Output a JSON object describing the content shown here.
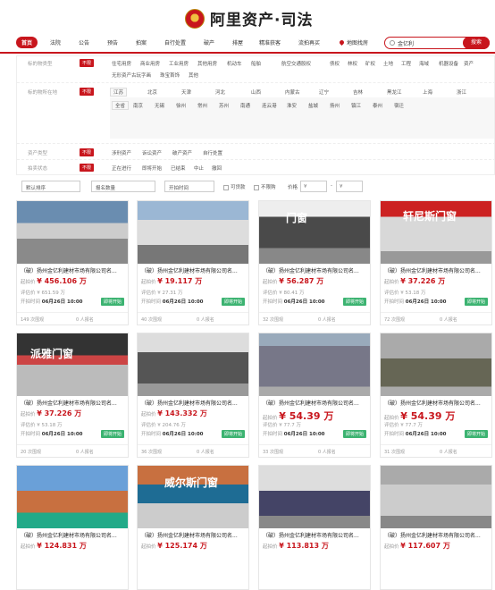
{
  "brand": {
    "title": "阿里资产·司法",
    "accent": "#c8161d"
  },
  "nav": {
    "items": [
      "首页",
      "法院",
      "公告",
      "预告",
      "拍案",
      "自行处置",
      "破产",
      "排屋",
      "精准获客",
      "流拍再买"
    ],
    "map_label": "地图找房",
    "search_value": "金亿利",
    "search_button": "搜索"
  },
  "filters": {
    "unlimited": "不限",
    "rows": [
      {
        "label": "标的物类型",
        "options": [
          "住宅用房",
          "商业用房",
          "工业用房",
          "其他用房",
          "机动车",
          "船舶",
          "航空交通",
          "股权",
          "债权",
          "林权",
          "矿权",
          "土地",
          "工程",
          "海域",
          "机器设备",
          "资产",
          "无形资产",
          "古玩字画",
          "珠宝首饰",
          "其他"
        ]
      },
      {
        "label": "标的物所在地",
        "provinces": [
          "江苏",
          "北京",
          "天津",
          "河北",
          "山西",
          "内蒙古",
          "辽宁",
          "吉林",
          "黑龙江",
          "上海",
          "浙江"
        ],
        "cities": [
          "全省",
          "南京",
          "无锡",
          "徐州",
          "常州",
          "苏州",
          "南通",
          "连云港",
          "淮安",
          "盐城",
          "扬州",
          "镇江",
          "泰州",
          "宿迁"
        ],
        "more_provinces": [
          "安徽",
          "福建",
          "江西",
          "山东",
          "河南",
          "湖北",
          "湖南",
          "广东",
          "广西",
          "海南",
          "重庆",
          "四川",
          "贵州",
          "云南",
          "西藏",
          "陕西",
          "甘肃",
          "青海",
          "宁夏",
          "新疆"
        ]
      },
      {
        "label": "资产类型",
        "options": [
          "涉刑资产",
          "诉讼资产",
          "破产资产",
          "自行处置"
        ]
      },
      {
        "label": "拍卖状态",
        "options": [
          "正在进行",
          "即将开始",
          "已结束",
          "中止",
          "撤回"
        ]
      }
    ]
  },
  "sort": {
    "default_label": "默认排序",
    "deposit_label": "报名数量",
    "time_label": "开拍时间",
    "loan_label": "可贷款",
    "limit_label": "不限购",
    "price_label": "价格",
    "price_from": "¥",
    "price_to": "¥"
  },
  "cards": [
    {
      "title": "（破）扬州金亿利建材市场有限公司名...",
      "start_label": "起拍价",
      "price": "¥ 456.106 万",
      "est_label": "评估价",
      "est": "¥ 651.59 万",
      "time_label": "开拍时间",
      "time": "06月26日 10:00",
      "status": "即将开始",
      "views": "149 次围观",
      "signups": "0 人报名"
    },
    {
      "title": "（破）扬州金亿利建材市场有限公司名...",
      "start_label": "起拍价",
      "price": "¥ 19.117 万",
      "est_label": "评估价",
      "est": "¥ 27.31 万",
      "time_label": "开拍时间",
      "time": "06月26日 10:00",
      "status": "即将开始",
      "views": "40 次围观",
      "signups": "0 人报名"
    },
    {
      "title": "（破）扬州金亿利建材市场有限公司名...",
      "start_label": "起拍价",
      "price": "¥ 56.287 万",
      "est_label": "评估价",
      "est": "¥ 80.41 万",
      "time_label": "开拍时间",
      "time": "06月26日 10:00",
      "status": "即将开始",
      "views": "32 次围观",
      "signups": "0 人报名"
    },
    {
      "title": "（破）扬州金亿利建材市场有限公司名...",
      "start_label": "起拍价",
      "price": "¥ 37.226 万",
      "est_label": "评估价",
      "est": "¥ 53.18 万",
      "time_label": "开拍时间",
      "time": "06月26日 10:00",
      "status": "即将开始",
      "views": "72 次围观",
      "signups": "0 人报名"
    },
    {
      "title": "（破）扬州金亿利建材市场有限公司名...",
      "start_label": "起拍价",
      "price": "¥ 37.226 万",
      "est_label": "评估价",
      "est": "¥ 53.18 万",
      "time_label": "开拍时间",
      "time": "06月26日 10:00",
      "status": "即将开始",
      "views": "20 次围观",
      "signups": "0 人报名"
    },
    {
      "title": "（破）扬州金亿利建材市场有限公司名...",
      "start_label": "起拍价",
      "price": "¥ 143.332 万",
      "est_label": "评估价",
      "est": "¥ 204.76 万",
      "time_label": "开拍时间",
      "time": "06月26日 10:00",
      "status": "即将开始",
      "views": "36 次围观",
      "signups": "0 人报名"
    },
    {
      "title": "（破）扬州金亿利建材市场有限公司名...",
      "start_label": "起拍价",
      "price": "¥ 54.39 万",
      "est_label": "评估价",
      "est": "¥ 77.7 万",
      "time_label": "开拍时间",
      "time": "06月26日 10:00",
      "status": "即将开始",
      "views": "33 次围观",
      "signups": "0 人报名"
    },
    {
      "title": "（破）扬州金亿利建材市场有限公司名...",
      "start_label": "起拍价",
      "price": "¥ 54.39 万",
      "est_label": "评估价",
      "est": "¥ 77.7 万",
      "time_label": "开拍时间",
      "time": "06月26日 10:00",
      "status": "即将开始",
      "views": "31 次围观",
      "signups": "0 人报名"
    },
    {
      "title": "（破）扬州金亿利建材市场有限公司名...",
      "start_label": "起拍价",
      "price": "¥ 124.831 万"
    },
    {
      "title": "（破）扬州金亿利建材市场有限公司名...",
      "start_label": "起拍价",
      "price": "¥ 125.174 万"
    },
    {
      "title": "（破）扬州金亿利建材市场有限公司名...",
      "start_label": "起拍价",
      "price": "¥ 113.813 万"
    },
    {
      "title": "（破）扬州金亿利建材市场有限公司名...",
      "start_label": "起拍价",
      "price": "¥ 117.607 万"
    }
  ],
  "image_texts": [
    "门窗",
    "轩尼斯门窗",
    "派雅门窗",
    "威尔斯门窗"
  ]
}
